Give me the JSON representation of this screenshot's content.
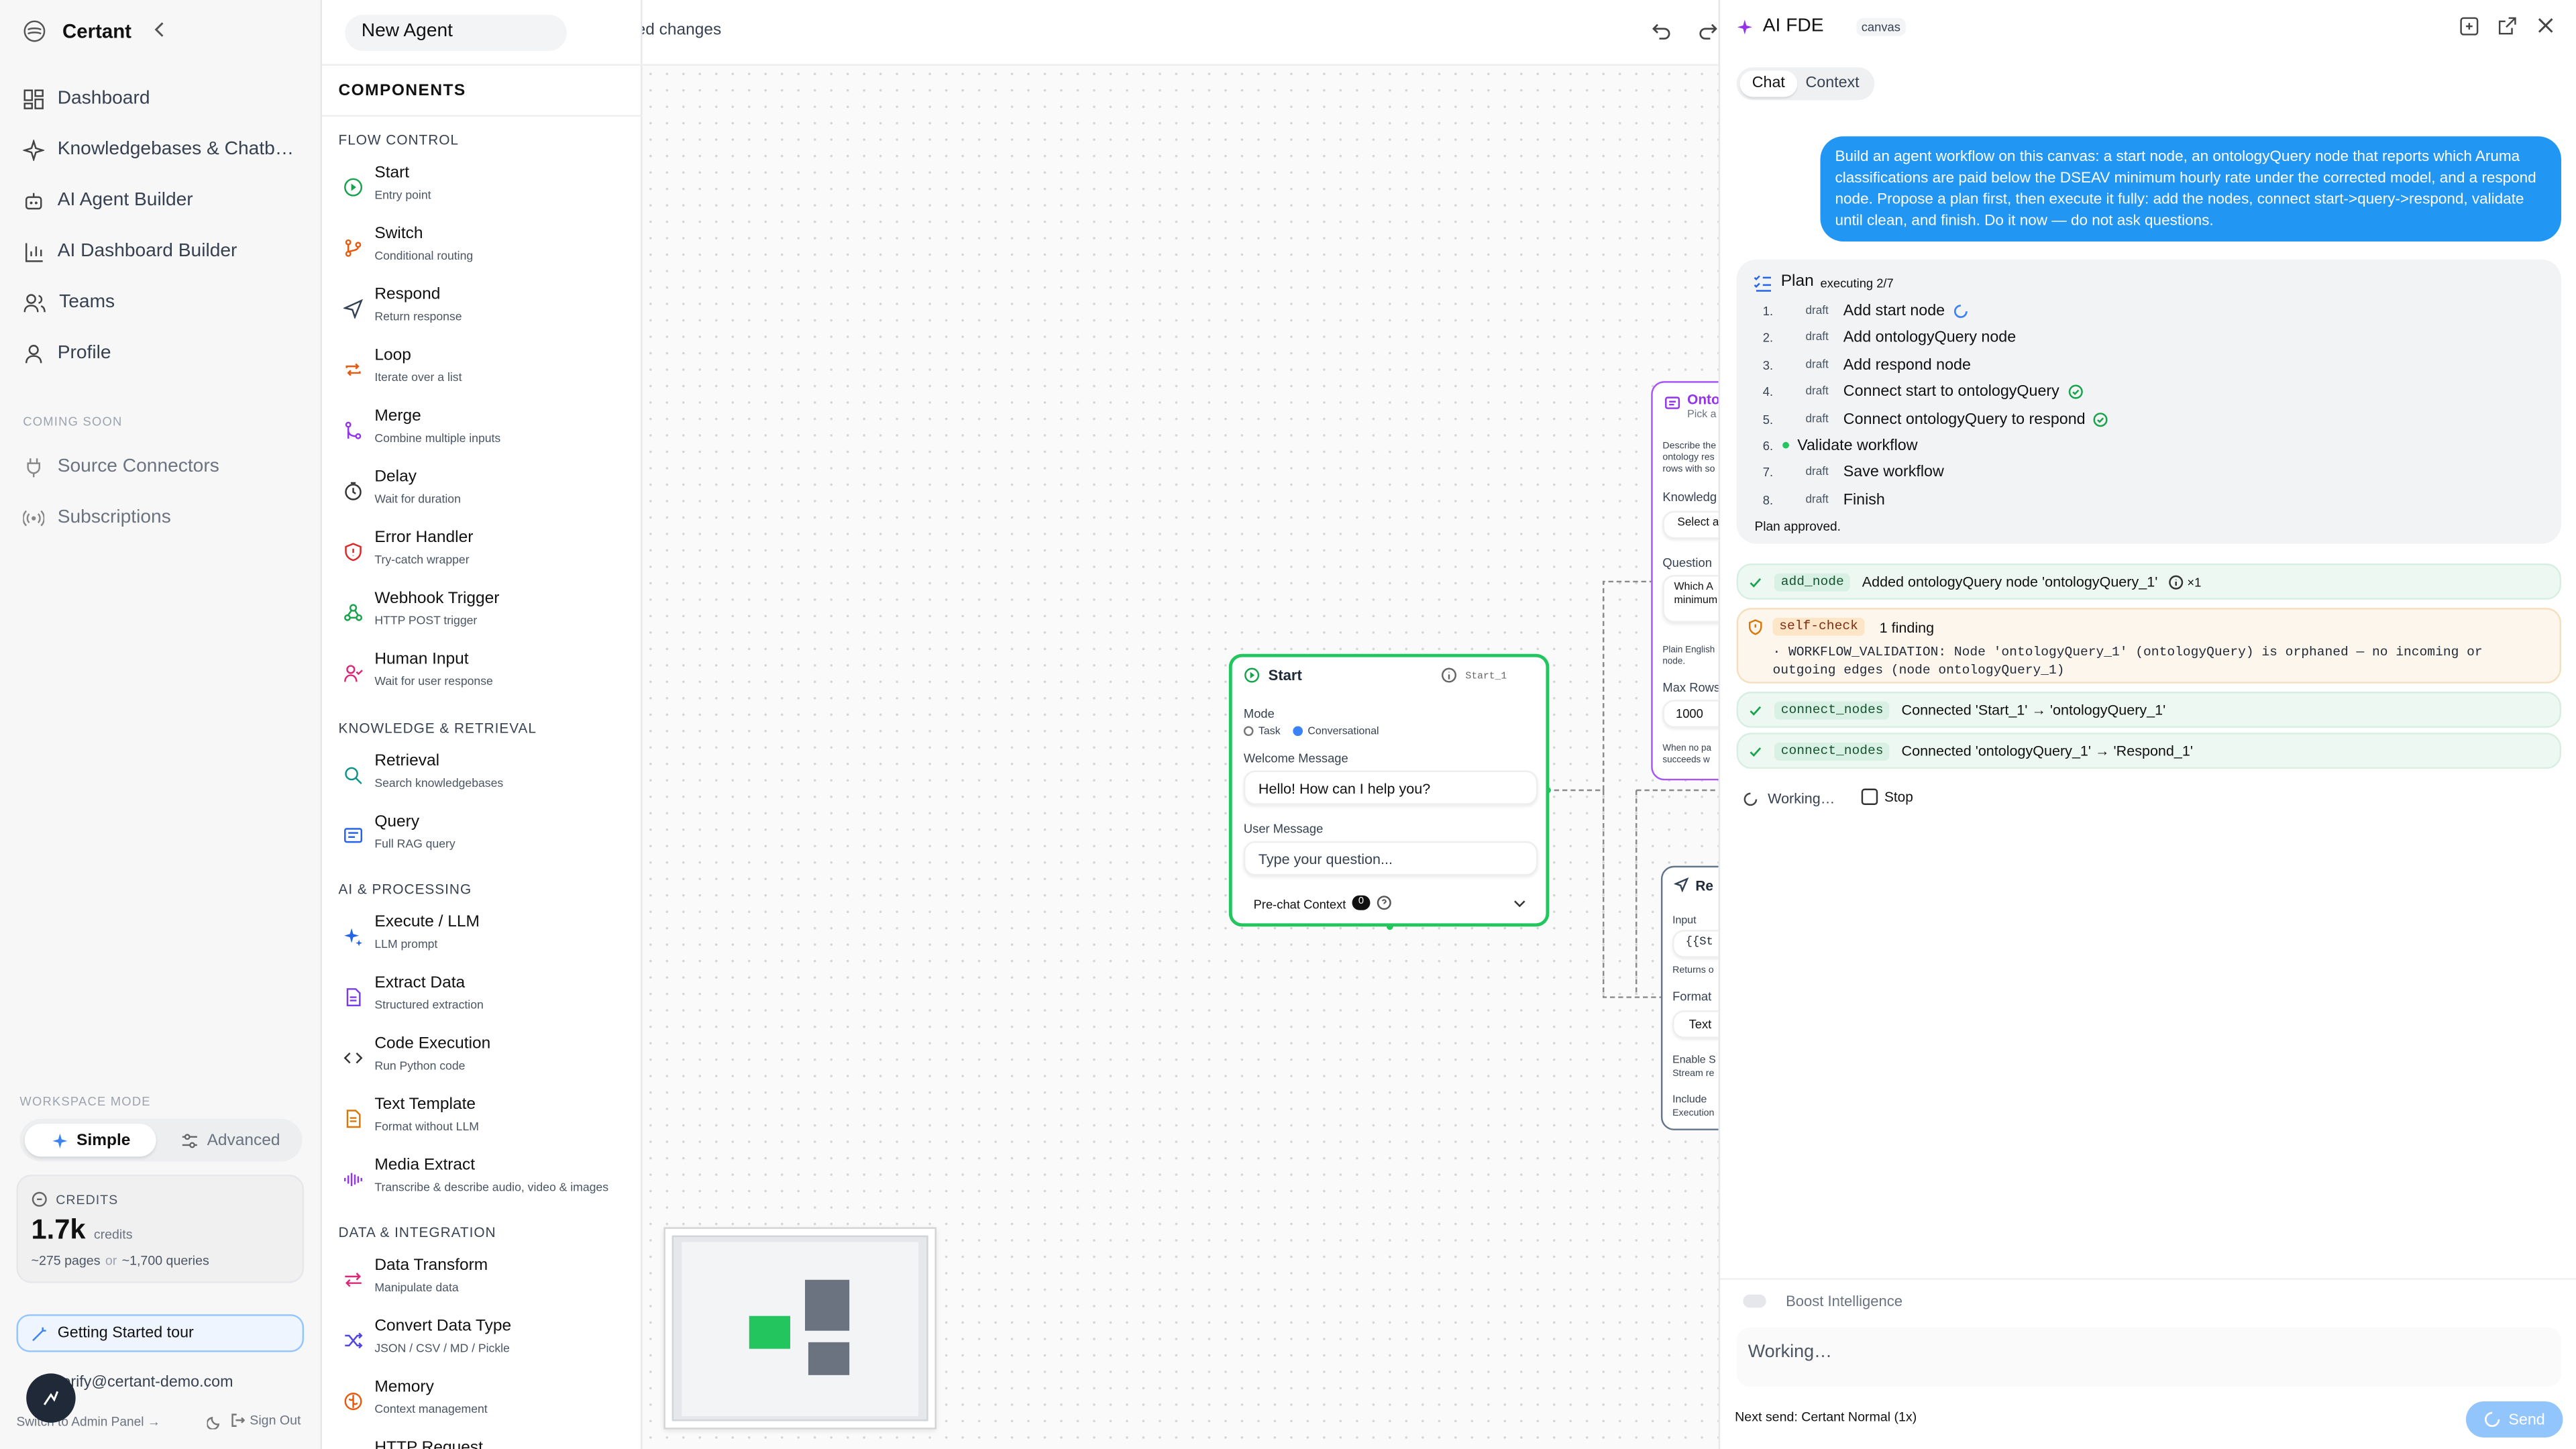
{
  "brand": "Certant",
  "nav": [
    {
      "label": "Dashboard"
    },
    {
      "label": "Knowledgebases & Chatb…"
    },
    {
      "label": "AI Agent Builder"
    },
    {
      "label": "AI Dashboard Builder"
    },
    {
      "label": "Teams"
    },
    {
      "label": "Profile"
    }
  ],
  "coming_soon": {
    "label": "COMING SOON",
    "items": [
      {
        "label": "Source Connectors"
      },
      {
        "label": "Subscriptions"
      }
    ]
  },
  "workspace_mode": {
    "label": "WORKSPACE MODE",
    "simple": "Simple",
    "advanced": "Advanced"
  },
  "credits": {
    "label": "CREDITS",
    "value": "1.7k",
    "unit": "credits",
    "detail_a": "~275 pages",
    "detail_or": "or",
    "detail_b": "~1,700 queries"
  },
  "tour": "Getting Started tour",
  "user_email": "verify@certant-demo.com",
  "admin_link": "Switch to Admin Panel →",
  "sign_out": "Sign Out",
  "agent_name": "New Agent",
  "unsaved": "Unsaved changes",
  "components": {
    "title": "COMPONENTS",
    "sections": [
      {
        "label": "FLOW CONTROL",
        "items": [
          {
            "title": "Start",
            "desc": "Entry point"
          },
          {
            "title": "Switch",
            "desc": "Conditional routing"
          },
          {
            "title": "Respond",
            "desc": "Return response"
          },
          {
            "title": "Loop",
            "desc": "Iterate over a list"
          },
          {
            "title": "Merge",
            "desc": "Combine multiple inputs"
          },
          {
            "title": "Delay",
            "desc": "Wait for duration"
          },
          {
            "title": "Error Handler",
            "desc": "Try-catch wrapper"
          },
          {
            "title": "Webhook Trigger",
            "desc": "HTTP POST trigger"
          },
          {
            "title": "Human Input",
            "desc": "Wait for user response"
          }
        ]
      },
      {
        "label": "KNOWLEDGE & RETRIEVAL",
        "items": [
          {
            "title": "Retrieval",
            "desc": "Search knowledgebases"
          },
          {
            "title": "Query",
            "desc": "Full RAG query"
          }
        ]
      },
      {
        "label": "AI & PROCESSING",
        "items": [
          {
            "title": "Execute / LLM",
            "desc": "LLM prompt"
          },
          {
            "title": "Extract Data",
            "desc": "Structured extraction"
          },
          {
            "title": "Code Execution",
            "desc": "Run Python code"
          },
          {
            "title": "Text Template",
            "desc": "Format without LLM"
          },
          {
            "title": "Media Extract",
            "desc": "Transcribe & describe audio, video & images"
          }
        ]
      },
      {
        "label": "DATA & INTEGRATION",
        "items": [
          {
            "title": "Data Transform",
            "desc": "Manipulate data"
          },
          {
            "title": "Convert Data Type",
            "desc": "JSON / CSV / MD / Pickle"
          },
          {
            "title": "Memory",
            "desc": "Context management"
          },
          {
            "title": "HTTP Request",
            "desc": ""
          }
        ]
      }
    ]
  },
  "start_node": {
    "title": "Start",
    "id": "Start_1",
    "mode_label": "Mode",
    "mode_task": "Task",
    "mode_conv": "Conversational",
    "welcome_label": "Welcome Message",
    "welcome_value": "Hello! How can I help you?",
    "user_label": "User Message",
    "user_placeholder": "Type your question...",
    "prechat": "Pre-chat Context",
    "prechat_count": "0"
  },
  "onto_node": {
    "title": "Onto",
    "subtitle": "Pick a",
    "desc": "Describe the ontology res rows with so",
    "kb_label": "Knowledg",
    "kb_select": "Select a",
    "q_label": "Question",
    "q_value": "Which A minimum",
    "plain": "Plain English node.",
    "max_label": "Max Rows",
    "max_value": "1000",
    "when": "When no pa succeeds w"
  },
  "resp_node": {
    "title": "Re",
    "input_label": "Input",
    "input_value": "{{St",
    "returns": "Returns o",
    "format_label": "Format",
    "format_value": "Text",
    "enable": "Enable S",
    "stream": "Stream re",
    "include": "Include",
    "execution": "Execution"
  },
  "fde": {
    "title": "AI FDE",
    "badge": "canvas",
    "tab_chat": "Chat",
    "tab_context": "Context",
    "user_message": "Build an agent workflow on this canvas: a start node, an ontologyQuery node that reports which Aruma classifications are paid below the DSEAV minimum hourly rate under the corrected model, and a respond node. Propose a plan first, then execute it fully: add the nodes, connect start->query->respond, validate until clean, and finish. Do it now — do not ask questions.",
    "plan_title": "Plan",
    "plan_status": "executing 2/7",
    "plan_steps": [
      {
        "n": "1.",
        "status": "draft",
        "text": "Add start node"
      },
      {
        "n": "2.",
        "status": "draft",
        "text": "Add ontologyQuery node"
      },
      {
        "n": "3.",
        "status": "draft",
        "text": "Add respond node"
      },
      {
        "n": "4.",
        "status": "draft",
        "text": "Connect start to ontologyQuery"
      },
      {
        "n": "5.",
        "status": "draft",
        "text": "Connect ontologyQuery to respond"
      },
      {
        "n": "6.",
        "status": "",
        "text": "Validate workflow"
      },
      {
        "n": "7.",
        "status": "draft",
        "text": "Save workflow"
      },
      {
        "n": "8.",
        "status": "draft",
        "text": "Finish"
      }
    ],
    "plan_approved": "Plan approved.",
    "tools": [
      {
        "tool": "add_node",
        "text": "Added ontologyQuery node 'ontologyQuery_1'",
        "count": "×1"
      }
    ],
    "self_check": {
      "tool": "self-check",
      "count": "1 finding",
      "detail": "· WORKFLOW_VALIDATION: Node 'ontologyQuery_1' (ontologyQuery) is orphaned — no incoming or outgoing edges (node ontologyQuery_1)"
    },
    "connects": [
      {
        "tool": "connect_nodes",
        "text": "Connected 'Start_1' → 'ontologyQuery_1'"
      },
      {
        "tool": "connect_nodes",
        "text": "Connected 'ontologyQuery_1' → 'Respond_1'"
      }
    ],
    "working": "Working…",
    "stop": "Stop",
    "boost": "Boost Intelligence",
    "input_placeholder": "Working…",
    "next_send": "Next send: Certant Normal (1x)",
    "send": "Send"
  },
  "colors": {
    "accent": "#2196f3",
    "start_green": "#22c55e",
    "onto_purple": "#a855f7",
    "resp_slate": "#64748b"
  }
}
